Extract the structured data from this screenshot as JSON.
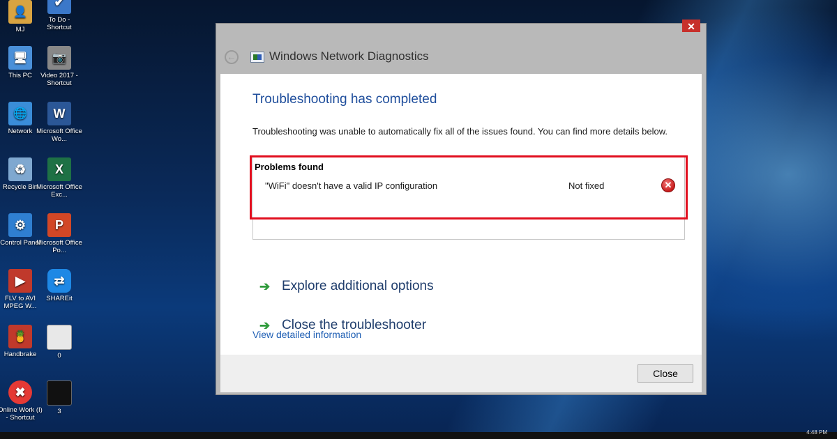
{
  "desktop": {
    "icons": [
      {
        "label": "MJ",
        "glyph": "👤",
        "color": "#d9a441"
      },
      {
        "label": "To Do - Shortcut",
        "glyph": "✔",
        "color": "#3b78c9"
      },
      {
        "label": "This PC",
        "glyph": "🖥",
        "color": "#4a90d9"
      },
      {
        "label": "Video 2017 - Shortcut",
        "glyph": "📷",
        "color": "#888888"
      },
      {
        "label": "Network",
        "glyph": "🌐",
        "color": "#3a8dd8"
      },
      {
        "label": "Microsoft Office Wo...",
        "glyph": "W",
        "color": "#2b5797"
      },
      {
        "label": "Recycle Bin",
        "glyph": "♻",
        "color": "#7fa8d0"
      },
      {
        "label": "Microsoft Office Exc...",
        "glyph": "X",
        "color": "#1e7145"
      },
      {
        "label": "Control Panel",
        "glyph": "⚙",
        "color": "#2f7fd1"
      },
      {
        "label": "Microsoft Office Po...",
        "glyph": "P",
        "color": "#d24726"
      },
      {
        "label": "FLV to AVI MPEG W...",
        "glyph": "▶",
        "color": "#c0392b"
      },
      {
        "label": "SHAREit",
        "glyph": "⇄",
        "color": "#1e88e5"
      },
      {
        "label": "Handbrake",
        "glyph": "🍍",
        "color": "#c0392b"
      },
      {
        "label": "0",
        "glyph": "",
        "color": "#e8e8e8"
      },
      {
        "label": "Online Work (I) - Shortcut",
        "glyph": "✖",
        "color": "#e53935"
      },
      {
        "label": "3",
        "glyph": "",
        "color": "#111111"
      }
    ]
  },
  "dialog": {
    "close_glyph": "✕",
    "back_glyph": "←",
    "title": "Windows Network Diagnostics",
    "heading": "Troubleshooting has completed",
    "description": "Troubleshooting was unable to automatically fix all of the issues found. You can find more details below.",
    "problems_label": "Problems found",
    "issue": {
      "text": "\"WiFi\" doesn't have a valid IP configuration",
      "status": "Not fixed",
      "icon_glyph": "✕"
    },
    "options": [
      {
        "label": "Explore additional options"
      },
      {
        "label": "Close the troubleshooter"
      }
    ],
    "arrow_glyph": "➔",
    "details_link": "View detailed information",
    "close_button": "Close"
  },
  "taskbar": {
    "clock": "4:48 PM"
  }
}
